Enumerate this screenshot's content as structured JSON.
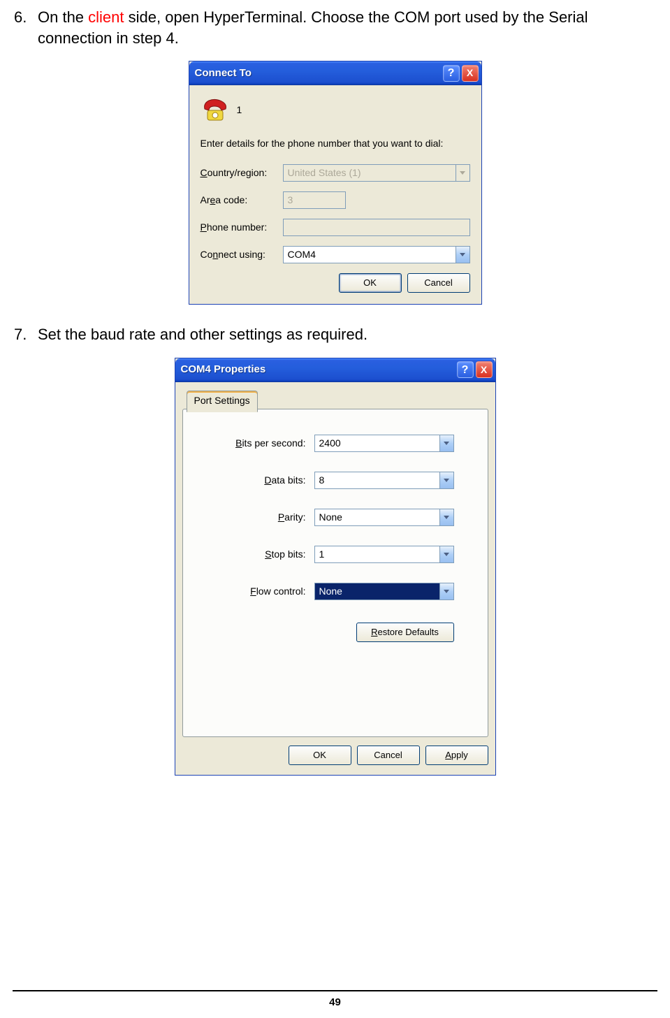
{
  "steps": {
    "six": {
      "num": "6.",
      "pre": "On the ",
      "highlight": "client",
      "post": " side, open HyperTerminal. Choose the COM port used by the Serial connection in step 4."
    },
    "seven": {
      "num": "7.",
      "text": "Set the baud rate and other settings as required."
    }
  },
  "dialog1": {
    "title": "Connect To",
    "help": "?",
    "close": "X",
    "conn_name": "1",
    "instruction": "Enter details for the phone number that you want to dial:",
    "labels": {
      "country": "Country/region:",
      "area": "Area code:",
      "phone": "Phone number:",
      "connect": "Connect using:"
    },
    "country_prefix": "C",
    "area_prefix": "e",
    "phone_prefix": "P",
    "connect_prefix": "n",
    "values": {
      "country": "United States (1)",
      "area": "3",
      "phone": "",
      "connect": "COM4"
    },
    "buttons": {
      "ok": "OK",
      "cancel": "Cancel"
    }
  },
  "dialog2": {
    "title": "COM4 Properties",
    "help": "?",
    "close": "X",
    "tab": "Port Settings",
    "fields": {
      "bps": {
        "label": "Bits per second:",
        "ul": "B",
        "value": "2400"
      },
      "data": {
        "label": "Data bits:",
        "ul": "D",
        "value": "8"
      },
      "parity": {
        "label": "Parity:",
        "ul": "P",
        "value": "None"
      },
      "stop": {
        "label": "Stop bits:",
        "ul": "S",
        "value": "1"
      },
      "flow": {
        "label": "Flow control:",
        "ul": "F",
        "value": "None"
      }
    },
    "restore": "Restore Defaults",
    "restore_ul": "R",
    "buttons": {
      "ok": "OK",
      "cancel": "Cancel",
      "apply": "Apply",
      "apply_ul": "A"
    }
  },
  "page_number": "49"
}
